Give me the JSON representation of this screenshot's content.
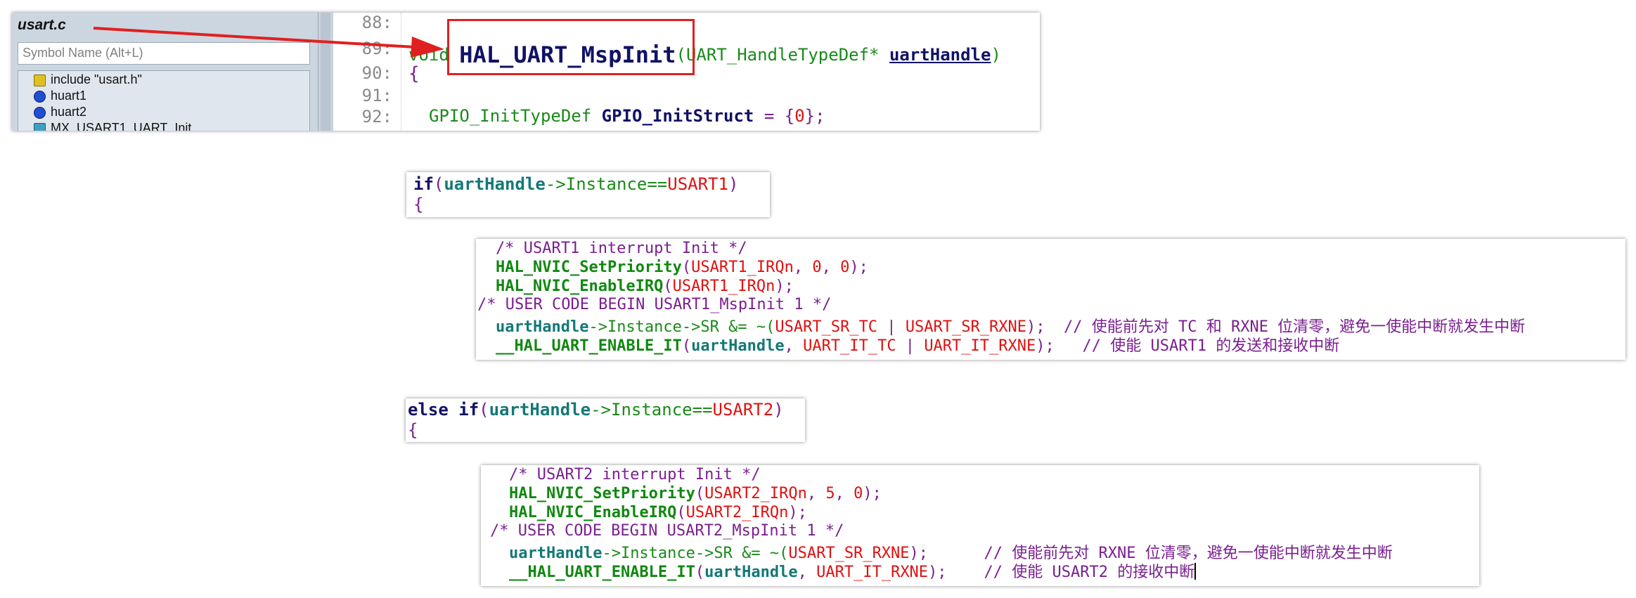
{
  "sidebar": {
    "file_name": "usart.c",
    "search_placeholder": "Symbol Name (Alt+L)",
    "items": [
      {
        "label": "include \"usart.h\"",
        "icon": "include-icon"
      },
      {
        "label": "huart1",
        "icon": "variable-icon"
      },
      {
        "label": "huart2",
        "icon": "variable-icon"
      },
      {
        "label": "MX_USART1_UART_Init",
        "icon": "function-icon"
      }
    ]
  },
  "top_editor": {
    "line_numbers": [
      "88:",
      "89:",
      "90:",
      "91:",
      "92:"
    ],
    "l89_void": "void ",
    "l89_func": "HAL_UART_MspInit",
    "l89_paren": "(",
    "l89_type": "UART_HandleTypeDef*",
    "l89_param": "uartHandle",
    "l89_close": ")",
    "l90": "{",
    "l92_type": "GPIO_InitTypeDef",
    "l92_var": "GPIO_InitStruct",
    "l92_eq": " = {",
    "l92_zero": "0",
    "l92_end": "};"
  },
  "block_if1": {
    "kw": "if",
    "open": "(",
    "handle": "uartHandle",
    "member": "->Instance==",
    "value": "USART1",
    "close": ")",
    "brace": "{"
  },
  "block_usart1": {
    "c1": "/* USART1 interrupt Init */",
    "l2_func": "HAL_NVIC_SetPriority",
    "l2_open": "(",
    "l2_arg1": "USART1_IRQn",
    "l2_sep1": ", ",
    "l2_arg2": "0",
    "l2_sep2": ", ",
    "l2_arg3": "0",
    "l2_end": ");",
    "l3_func": "HAL_NVIC_EnableIRQ",
    "l3_open": "(",
    "l3_arg": "USART1_IRQn",
    "l3_end": ");",
    "c4": "/* USER CODE BEGIN USART1_MspInit 1 */",
    "l5_handle": "uartHandle",
    "l5_member": "->Instance->SR &= ~(",
    "l5_a": "USART_SR_TC",
    "l5_pipe": " | ",
    "l5_b": "USART_SR_RXNE",
    "l5_end": ");",
    "l5_comment": "// 使能前先对 TC 和 RXNE 位清零，避免一使能中断就发生中断",
    "l6_func": "__HAL_UART_ENABLE_IT",
    "l6_open": "(",
    "l6_handle": "uartHandle",
    "l6_sep": ", ",
    "l6_a": "UART_IT_TC",
    "l6_pipe": " | ",
    "l6_b": "UART_IT_RXNE",
    "l6_end": ");",
    "l6_comment": "// 使能 USART1 的发送和接收中断"
  },
  "block_elseif": {
    "kw": "else if",
    "open": "(",
    "handle": "uartHandle",
    "member": "->Instance==",
    "value": "USART2",
    "close": ")",
    "brace": "{"
  },
  "block_usart2": {
    "c1": "/* USART2 interrupt Init */",
    "l2_func": "HAL_NVIC_SetPriority",
    "l2_open": "(",
    "l2_arg1": "USART2_IRQn",
    "l2_sep1": ", ",
    "l2_arg2": "5",
    "l2_sep2": ", ",
    "l2_arg3": "0",
    "l2_end": ");",
    "l3_func": "HAL_NVIC_EnableIRQ",
    "l3_open": "(",
    "l3_arg": "USART2_IRQn",
    "l3_end": ");",
    "c4": "/* USER CODE BEGIN USART2_MspInit 1 */",
    "l5_handle": "uartHandle",
    "l5_member": "->Instance->SR &= ~(",
    "l5_a": "USART_SR_RXNE",
    "l5_end": ");",
    "l5_comment": "// 使能前先对 RXNE 位清零，避免一使能中断就发生中断",
    "l6_func": "__HAL_UART_ENABLE_IT",
    "l6_open": "(",
    "l6_handle": "uartHandle",
    "l6_sep": ", ",
    "l6_a": "UART_IT_RXNE",
    "l6_end": ");",
    "l6_comment": "// 使能 USART2 的接收中断"
  },
  "colors": {
    "highlight_box": "#e02020",
    "arrow": "#e02020"
  }
}
